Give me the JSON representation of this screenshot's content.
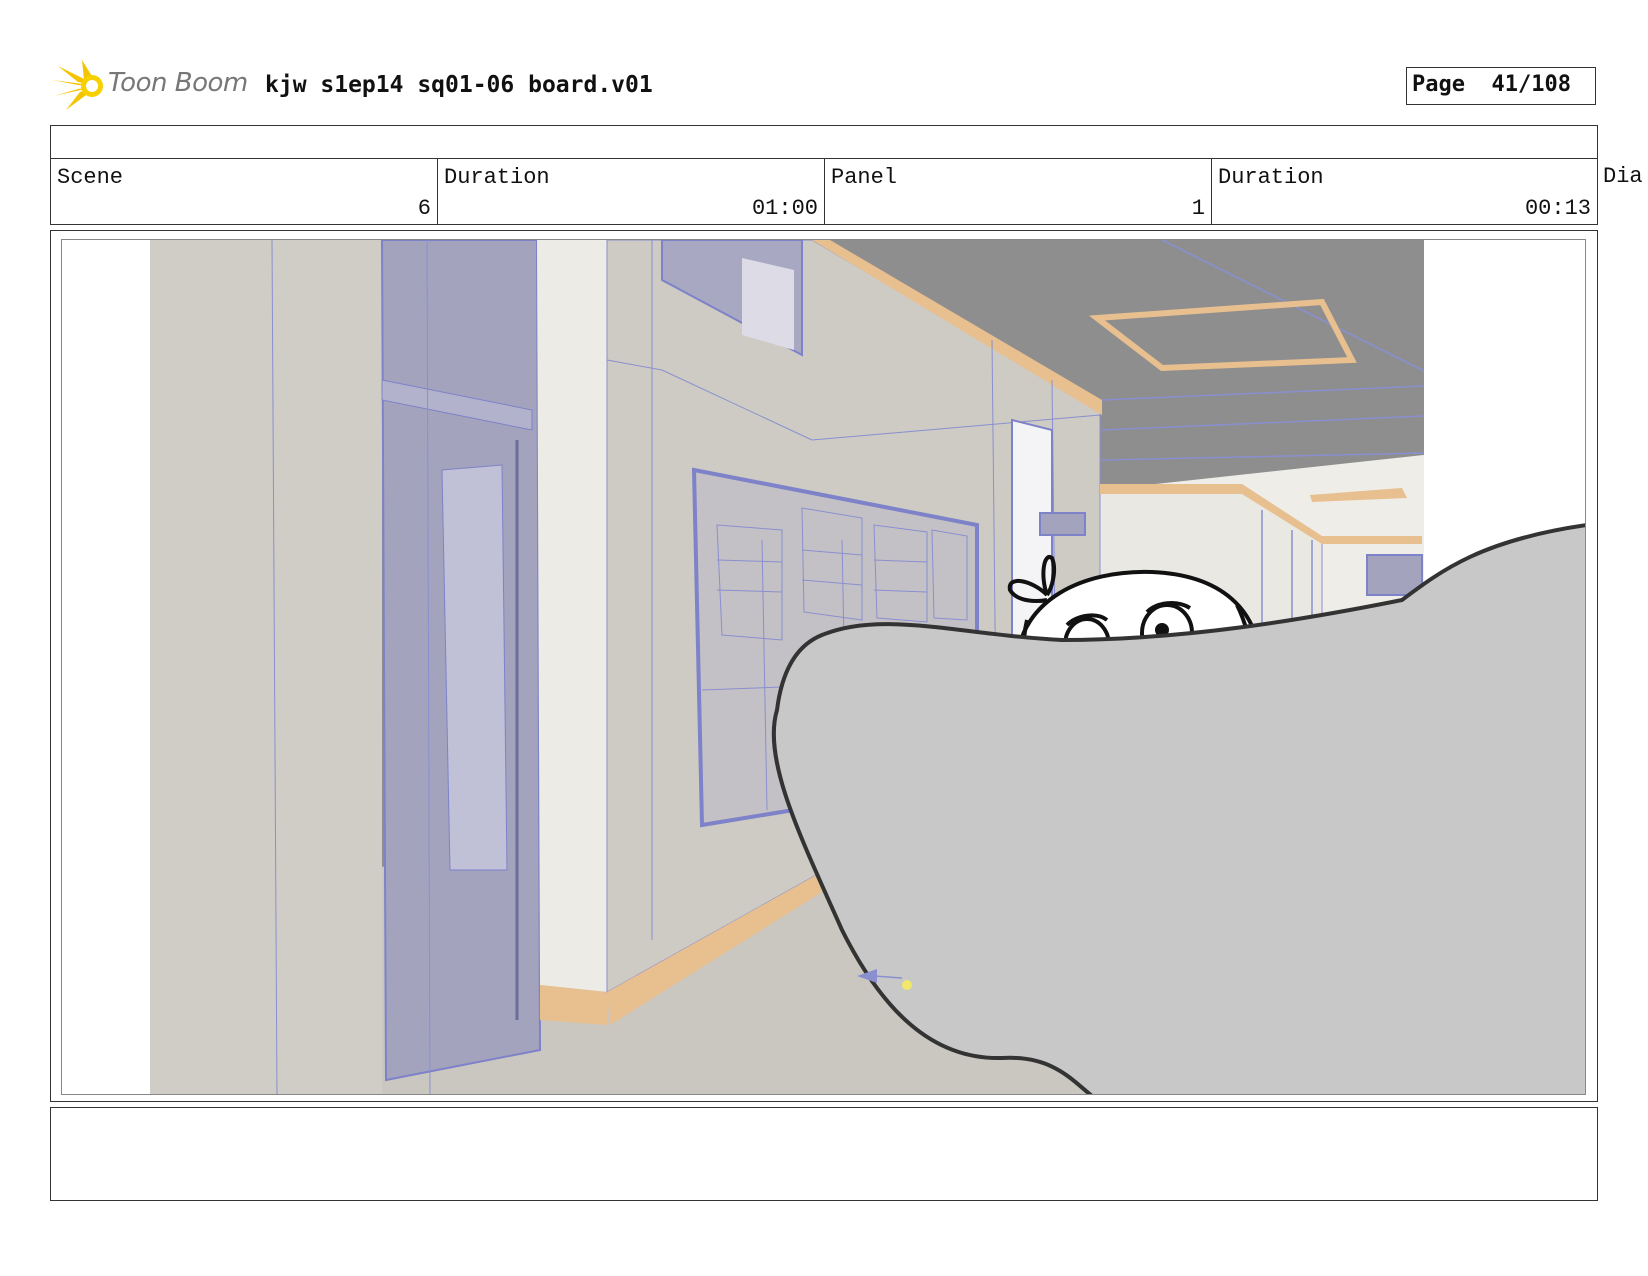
{
  "header": {
    "logo_text": "Toon Boom",
    "document_title": "kjw s1ep14 sq01-06 board.v01",
    "page_label": "Page",
    "page_value": "41/108"
  },
  "info": {
    "scene_label": "Scene",
    "scene_value": "6",
    "scene_duration_label": "Duration",
    "scene_duration_value": "01:00",
    "panel_label": "Panel",
    "panel_value": "1",
    "panel_duration_label": "Duration",
    "panel_duration_value": "00:13",
    "dialog_label_partial": "Dia"
  },
  "colors": {
    "logo_yellow": "#f5c400",
    "wireframe_blue": "#8a8fd0",
    "wall": "#cdcbc3",
    "ceiling": "#8e8e8e",
    "trim_orange": "#e8bf8f",
    "foreground_shape": "#c8c8c8"
  },
  "icons": {
    "logo": "toon-boom-starburst-icon"
  }
}
